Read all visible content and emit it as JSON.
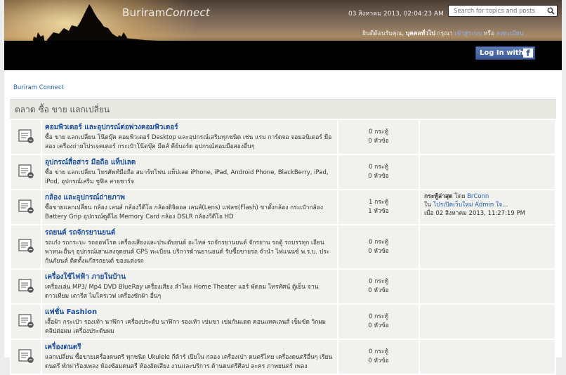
{
  "site": {
    "name_regular": "Buriram",
    "name_italic": "Connect"
  },
  "header": {
    "datetime": "03 สิงหาคม 2013, 02:04:23 AM",
    "search_placeholder": "Search for topics and posts",
    "welcome": {
      "prefix": "ยินดีต้อนรับคุณ, ",
      "guest": "บุคคลทั่วไป",
      "mid": " กรุณา ",
      "login": "เข้าสู่ระบบ",
      "or": " หรือ ",
      "register": "ลงทะเบียน"
    },
    "facebook_label": "Log In with",
    "facebook_icon": "f"
  },
  "breadcrumb": "Buriram Connect",
  "category": "ตลาด ซื้อ ขาย แลกเปลี่ยน",
  "forums": [
    {
      "title": "คอมพิวเตอร์ และอุปกรณ์ต่อพ่วงคอมพิวเตอร์",
      "desc": "ซื้อ ขาย แลกเปลี่ยน โน๊ตบุ๊ค คอมพิวเตอร์ Desktop และอุปกรณ์เสริมทุกชนิด เช่น แรม การ์ดจอ จอมอนิเตอร์ มือสอง เครื่องถ่ายโปรเจคเตอร์ กระเป๋าโน๊ตบุ๊ค มีดส์ คีย์บอร์ด อุปกรณ์คอมมือสองอื่นๆ",
      "posts": "0 กระทู้",
      "replies": "0 หัวข้อ",
      "last": null
    },
    {
      "title": "อุปกรณ์สื่อสาร มือถือ แท็ปเลต",
      "desc": "ซื้อ ขาย แลกเปลี่ยน โทรศัพท์มือถือ สมาร์ทโฟน แท็ปเลต iPhone, iPad, Android Phone, BlackBerry, iPad, iPod, อุปกรณ์เสริม ชูฟิล สายชาร์จ",
      "posts": "0 กระทู้",
      "replies": "0 หัวข้อ",
      "last": null
    },
    {
      "title": "กล้อง และอุปกรณ์ถ่ายภาพ",
      "desc": "ซื้อขายแลกเปลี่ยน กล้อง เลนส์ กล้องวีดีโอ กล้องดิจิตอล เลนส์(Lens) แฟลช(Flash) ขาตั้งกล้อง กระเป๋ากล้อง Battery Grip อุปกรณ์ดูดีไอ Memory Card กล้อง DSLR กล้องวีดีโอ HD",
      "posts": "1 กระทู้",
      "replies": "1 หัวข้อ",
      "last": {
        "label": "กระทู้ล่าสุด",
        "by": "โดย",
        "author": "BrConn",
        "in": "ใน",
        "topic": "โปรเปิดเว็บใหม่ Admin ใจ...",
        "when": "เมื่อ 02 สิงหาคม 2013, 11:27:19 PM"
      }
    },
    {
      "title": "รถยนต์ รถจักรยานยนต์",
      "desc": "รถเก๋ง รถกระบะ รถออฟโรด เครื่องเสียงและประดับยนต์ อะไหล่ รถจักรยานยนต์ จักรยาน รถตู้ รถบรรทุก เอียนพาหนะอื่นๆ อุปกรณ์เสาแสงจุดยนต์ GPS ทะเบียน บริการด้านยานยนต์ รับซื้อขายรถ จำนำ ไฟแนนซ์ พ.ร.บ. ประกันภัยนต์ ติดตั้งแก๊สรถยนต์ ของแต่งรถ",
      "posts": "0 กระทู้",
      "replies": "0 หัวข้อ",
      "last": null
    },
    {
      "title": "เครื่องใช้ไฟฟ้า ภายในบ้าน",
      "desc": "เครื่องเล่น MP3/ Mp4 DVD BlueRay เครื่องเสียง ลำโพง Home Theater แอร์ พัดลม โทรทัศน์ ตู้เย็น จานดาวเทียม เตารีด ไมโครเวฟ เครื่องซักผ้า อื่นๆ",
      "posts": "0 กระทู้",
      "replies": "0 หัวข้อ",
      "last": null
    },
    {
      "title": "แฟชั่น Fashion",
      "desc": "เสื้อผ้า กระเป๋า รองเท้า นาฬิกา เครื่องประดับ นาฬิกา รองเท้า เข่มขา เข่มกันแดด คอนแทคเลนส์ เข็มขัด วิกผม คลิปต่อผม เครื่องประดับผม",
      "posts": "0 กระทู้",
      "replies": "0 หัวข้อ",
      "last": null
    },
    {
      "title": "เครื่องดนตรี",
      "desc": "แลกเปลี่ยน ซื้อขายเครื่องดนตรี ทุกชนิด Ukulele กีต้าร์ เปียโน กลอง เครื่องเป่า ดนตรีไทย เครื่องดนตรีอื่นๆ เรียนดนตรี พักผ่าร้องเพลง ห้องซ้อมดนตรี ห้องอัดเสียง งานและบริการ ด้านดนตรีศิลป ละคร ภาพยนตร์ เพลง",
      "posts": "0 กระทู้",
      "replies": "0 หัวข้อ",
      "last": null
    }
  ]
}
